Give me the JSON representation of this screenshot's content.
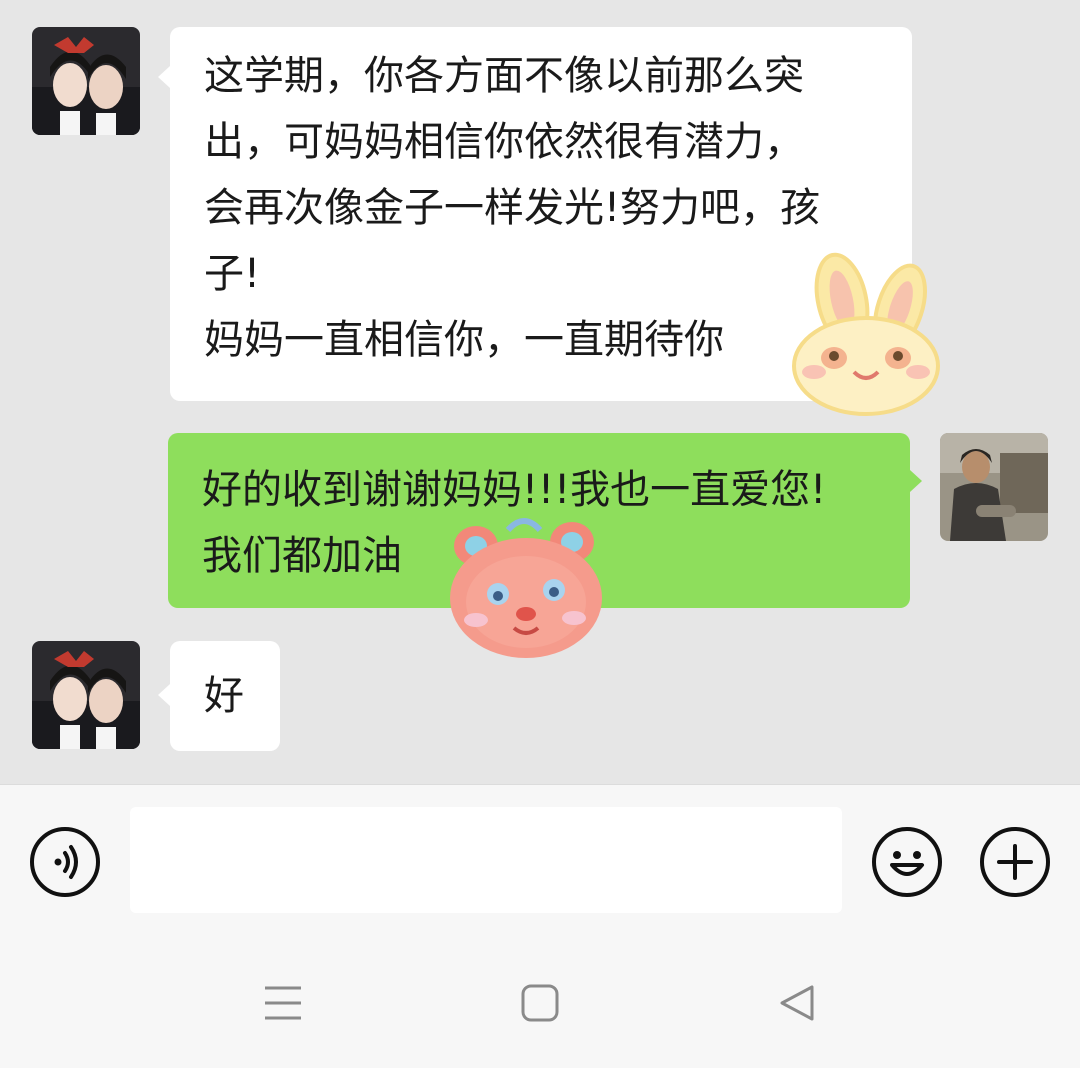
{
  "messages": [
    {
      "side": "left",
      "lines": [
        "这学期，你各方面不像以前那么突",
        "出，可妈妈相信你依然很有潜力，",
        "会再次像金子一样发光!努力吧，孩",
        "子!",
        "妈妈一直相信你，一直期待你"
      ],
      "sticker": "bunny-face-sticker"
    },
    {
      "side": "right",
      "lines": [
        "好的收到谢谢妈妈!!!我也一直爱您!",
        "我们都加油"
      ],
      "sticker": "pink-tiger-face-sticker"
    },
    {
      "side": "left",
      "lines": [
        "好"
      ]
    }
  ],
  "input_bar": {
    "voice_icon": "voice-icon",
    "text_value": "",
    "emoji_icon": "emoji-smile-icon",
    "plus_icon": "plus-icon"
  },
  "nav": {
    "menu_icon": "menu-icon",
    "home_icon": "home-square-icon",
    "back_icon": "back-triangle-icon"
  },
  "colors": {
    "chat_background": "#e6e6e6",
    "incoming_bubble": "#ffffff",
    "outgoing_bubble": "#8ede5c",
    "bar_background": "#f7f7f7"
  }
}
